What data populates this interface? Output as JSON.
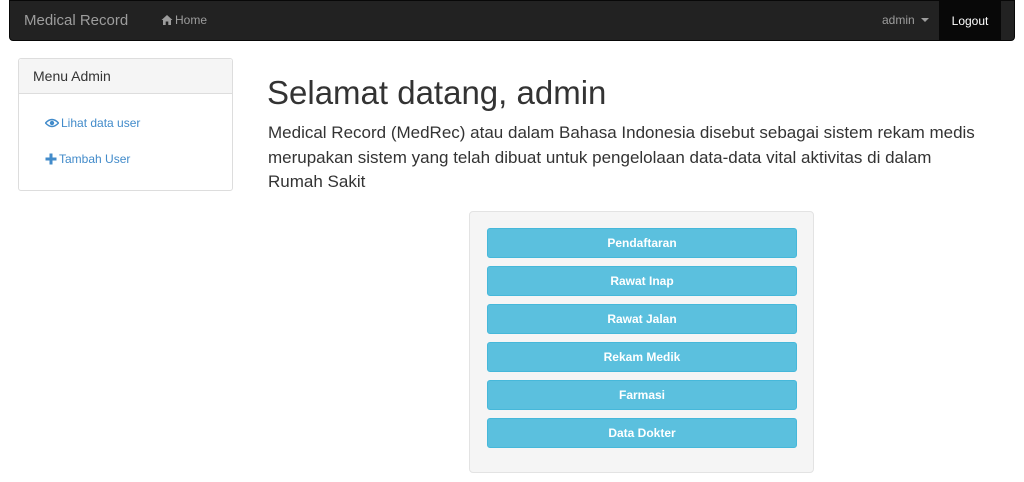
{
  "navbar": {
    "brand": "Medical Record",
    "home_label": "Home",
    "user_label": "admin",
    "logout_label": "Logout"
  },
  "sidebar": {
    "title": "Menu Admin",
    "items": [
      {
        "label": "Lihat data user",
        "icon": "eye-icon"
      },
      {
        "label": "Tambah User",
        "icon": "plus-icon"
      }
    ]
  },
  "main": {
    "title": "Selamat datang, admin",
    "intro": "Medical Record (MedRec) atau dalam Bahasa Indonesia disebut sebagai sistem rekam medis merupakan sistem yang telah dibuat untuk pengelolaan data-data vital aktivitas di dalam Rumah Sakit",
    "buttons": [
      "Pendaftaran",
      "Rawat Inap",
      "Rawat Jalan",
      "Rekam Medik",
      "Farmasi",
      "Data Dokter"
    ]
  },
  "colors": {
    "navbar_bg": "#222222",
    "accent_info": "#5bc0de",
    "link": "#428bca"
  }
}
